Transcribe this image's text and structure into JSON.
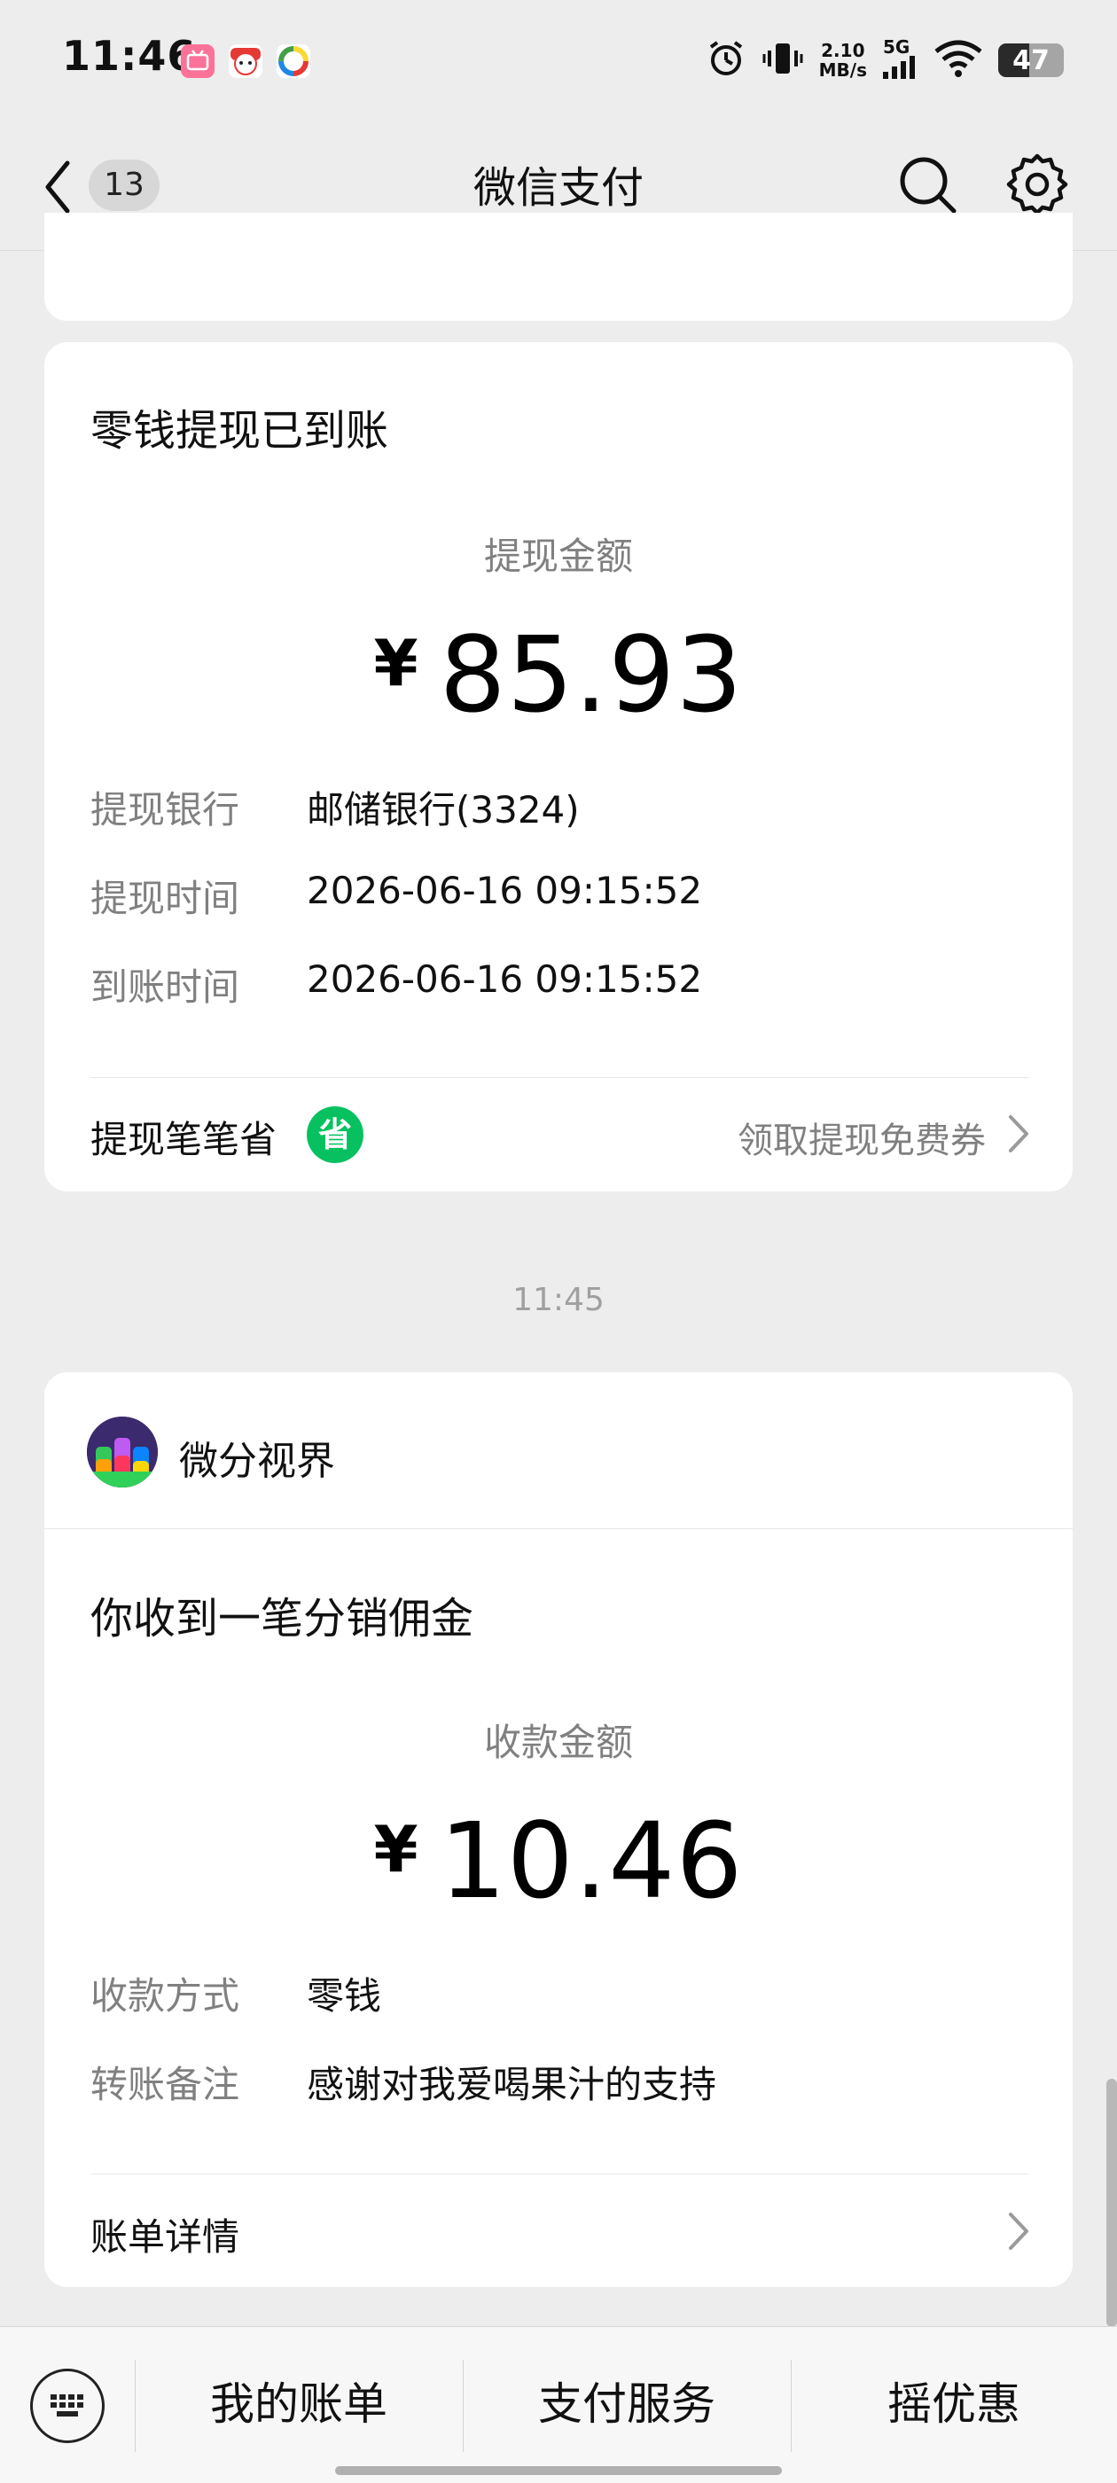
{
  "status_bar": {
    "time": "11:46",
    "net_speed_value": "2.10",
    "net_speed_unit": "MB/s",
    "network_gen": "5G",
    "battery": "47",
    "icons": [
      "bilibili-app-icon",
      "alarm-icon",
      "vibrate-icon",
      "signal-icon",
      "wifi-icon",
      "battery-icon"
    ]
  },
  "nav": {
    "title": "微信支付",
    "unread_count": "13",
    "icons": [
      "back-chevron-icon",
      "search-icon",
      "settings-gear-icon"
    ]
  },
  "withdrawal_card": {
    "title": "零钱提现已到账",
    "amount_label": "提现金额",
    "currency": "¥",
    "amount": "85.93",
    "rows": [
      {
        "label": "提现银行",
        "value": "邮储银行(3324)"
      },
      {
        "label": "提现时间",
        "value": "2026-06-16 09:15:52"
      },
      {
        "label": "到账时间",
        "value": "2026-06-16 09:15:52"
      }
    ],
    "promo_label": "提现笔笔省",
    "promo_badge": "省",
    "promo_link": "领取提现免费券"
  },
  "timestamp": "11:45",
  "commission_card": {
    "merchant": "微分视界",
    "title": "你收到一笔分销佣金",
    "amount_label": "收款金额",
    "currency": "¥",
    "amount": "10.46",
    "rows": [
      {
        "label": "收款方式",
        "value": "零钱"
      },
      {
        "label": "转账备注",
        "value": "感谢对我爱喝果汁的支持"
      }
    ],
    "detail_link": "账单详情"
  },
  "bottom_menu": {
    "items": [
      "我的账单",
      "支付服务",
      "摇优惠"
    ]
  },
  "colors": {
    "background": "#ededed",
    "card": "#ffffff",
    "badge_green": "#07c160",
    "label_gray": "#808080"
  }
}
